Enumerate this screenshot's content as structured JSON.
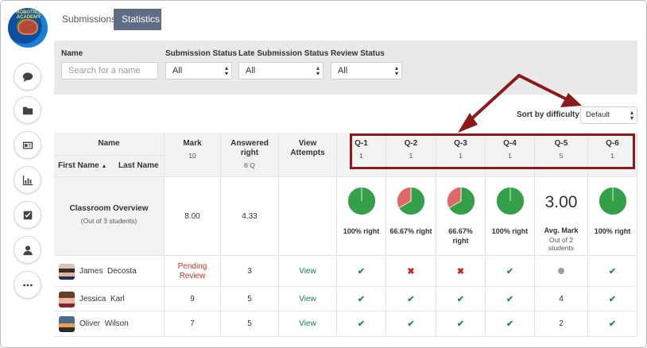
{
  "tabs": [
    {
      "label": "Submissions",
      "active": false
    },
    {
      "label": "Statistics",
      "active": true
    }
  ],
  "sidebar": {
    "logo_text": "ROBOTICS ACADEMY",
    "buttons": [
      "chat-icon",
      "folder-icon",
      "id-card-icon",
      "bar-chart-icon",
      "checkbox-icon",
      "user-icon",
      "more-icon"
    ]
  },
  "filters": {
    "name": {
      "label": "Name",
      "placeholder": "Search for a name"
    },
    "submission_status": {
      "label": "Submission Status",
      "value": "All"
    },
    "late_submission_status": {
      "label": "Late Submission Status",
      "value": "All"
    },
    "review_status": {
      "label": "Review Status",
      "value": "All"
    }
  },
  "sort": {
    "label": "Sort by difficulty",
    "value": "Default"
  },
  "table": {
    "headers": {
      "name": "Name",
      "first_name": "First Name",
      "sort_indicator": "▲",
      "last_name": "Last Name",
      "mark": "Mark",
      "mark_sub": "10",
      "answered": "Answered right",
      "answered_sub": "6 Q",
      "view_attempts": "View Attempts"
    },
    "questions": [
      {
        "label": "Q-1",
        "points": "1"
      },
      {
        "label": "Q-2",
        "points": "1"
      },
      {
        "label": "Q-3",
        "points": "1"
      },
      {
        "label": "Q-4",
        "points": "1"
      },
      {
        "label": "Q-5",
        "points": "5"
      },
      {
        "label": "Q-6",
        "points": "1"
      }
    ],
    "overview": {
      "title": "Classroom Overview",
      "subtitle": "(Out of 3 students)",
      "mark": "8.00",
      "answered": "4.33",
      "questions": [
        {
          "type": "pie",
          "percent_right": 100,
          "label": "100% right"
        },
        {
          "type": "pie",
          "percent_right": 66.67,
          "label": "66.67% right"
        },
        {
          "type": "pie",
          "percent_right": 66.67,
          "label": "66.67% right"
        },
        {
          "type": "pie",
          "percent_right": 100,
          "label": "100% right"
        },
        {
          "type": "avg",
          "value": "3.00",
          "label": "Avg. Mark",
          "sub": "Out of 2 students"
        },
        {
          "type": "pie",
          "percent_right": 100,
          "label": "100% right"
        }
      ]
    },
    "students": [
      {
        "first": "James",
        "last": "Decosta",
        "mark": "Pending Review",
        "mark_pending": true,
        "answered": "3",
        "view": "View",
        "results": [
          "check",
          "cross",
          "cross",
          "check",
          "pending",
          "check"
        ]
      },
      {
        "first": "Jessica",
        "last": "Karl",
        "mark": "9",
        "mark_pending": false,
        "answered": "5",
        "view": "View",
        "results": [
          "check",
          "check",
          "check",
          "check",
          "4",
          "check"
        ]
      },
      {
        "first": "Oliver",
        "last": "Wilson",
        "mark": "7",
        "mark_pending": false,
        "answered": "5",
        "view": "View",
        "results": [
          "check",
          "check",
          "check",
          "check",
          "2",
          "check"
        ]
      }
    ]
  },
  "colors": {
    "pie_right": "#34a04a",
    "pie_wrong": "#e06767",
    "annotation": "#8b1a1a",
    "tab_active": "#5e6d85"
  }
}
